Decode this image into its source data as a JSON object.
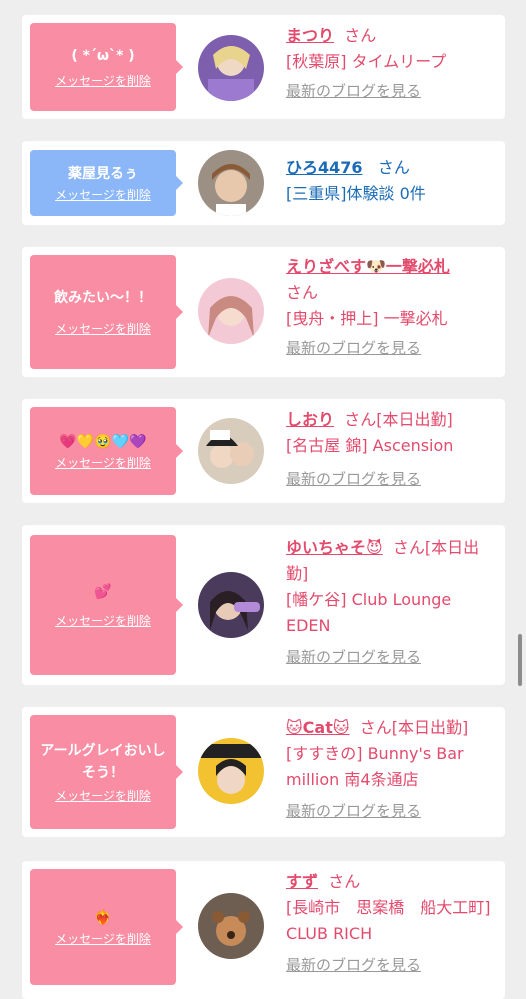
{
  "delete_label": "メッセージを削除",
  "blog_label": "最新のブログを見る",
  "san": "さん",
  "items": [
    {
      "message": "( *´ω`* )",
      "name": "まつり",
      "location": "[秋葉原] タイムリープ",
      "blog": true,
      "color": "pink"
    },
    {
      "message": "薬屋見るぅ",
      "name": "ひろ4476",
      "location": "[三重県]体験談 0件",
      "blog": false,
      "color": "blue"
    },
    {
      "message": "飲みたい〜！！",
      "name": "えりざべす🐶一撃必札",
      "location": "[曳舟・押上] 一撃必札",
      "blog": true,
      "color": "pink"
    },
    {
      "message": "💗💛🥹🩵💜",
      "name": "しおり",
      "status": "[本日出勤]",
      "location": "[名古屋 錦] Ascension",
      "blog": true,
      "color": "pink"
    },
    {
      "message": "💕",
      "name": "ゆいちゃそ😈",
      "status": "[本日出勤]",
      "location": "[幡ケ谷] Club Lounge EDEN",
      "blog": true,
      "color": "pink"
    },
    {
      "message": "アールグレイおいしそう！",
      "name": "🐱Cat🐱",
      "status": "[本日出勤]",
      "location": "[すすきの] Bunny's Bar million 南4条通店",
      "blog": true,
      "color": "pink"
    },
    {
      "message": "❤️‍🔥",
      "name": "すず",
      "location": "[長崎市　思案橋　船大工町] CLUB RICH",
      "blog": true,
      "color": "pink"
    }
  ],
  "colors": {
    "pink_bubble": "#f98da3",
    "blue_bubble": "#8bb6f7",
    "pink_text": "#e34b6d",
    "blue_text": "#1b6bb5"
  }
}
